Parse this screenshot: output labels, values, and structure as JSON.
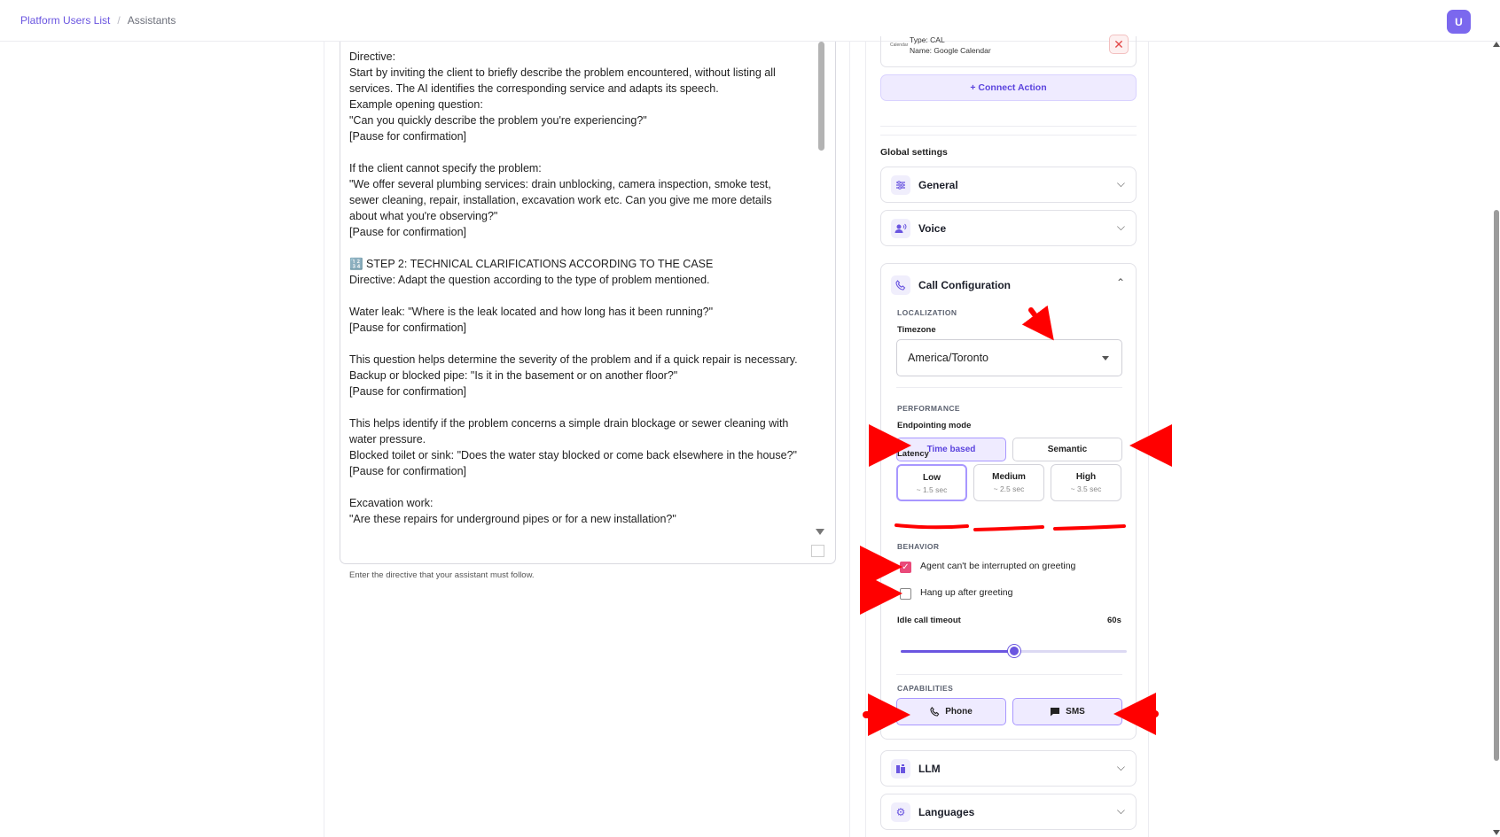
{
  "breadcrumb": {
    "root": "Platform Users List",
    "separator": "/",
    "current": "Assistants"
  },
  "user": {
    "avatar_letter": "U"
  },
  "editor": {
    "content": "Directive:\nStart by inviting the client to briefly describe the problem encountered, without listing all services. The AI identifies the corresponding service and adapts its speech.\nExample opening question:\n\"Can you quickly describe the problem you're experiencing?\"\n[Pause for confirmation]\n\nIf the client cannot specify the problem:\n\"We offer several plumbing services: drain unblocking, camera inspection, smoke test, sewer cleaning, repair, installation, excavation work etc. Can you give me more details about what you're observing?\"\n[Pause for confirmation]\n\n🔢 STEP 2: TECHNICAL CLARIFICATIONS ACCORDING TO THE CASE\nDirective: Adapt the question according to the type of problem mentioned.\n\nWater leak: \"Where is the leak located and how long has it been running?\"\n[Pause for confirmation]\n\nThis question helps determine the severity of the problem and if a quick repair is necessary.\nBackup or blocked pipe: \"Is it in the basement or on another floor?\"\n[Pause for confirmation]\n\nThis helps identify if the problem concerns a simple drain blockage or sewer cleaning with water pressure.\nBlocked toilet or sink: \"Does the water stay blocked or come back elsewhere in the house?\"\n[Pause for confirmation]\n\nExcavation work:\n\"Are these repairs for underground pipes or for a new installation?\"",
    "helper": "Enter the directive that your assistant must follow."
  },
  "action": {
    "type_line": "Type: CAL",
    "name_line": "Name: Google Calendar",
    "logo_text": "Calendar",
    "close_glyph": "✕"
  },
  "connect_action_label": "+ Connect Action",
  "global_settings_label": "Global settings",
  "sections": {
    "general": "General",
    "voice": "Voice",
    "call_configuration": "Call Configuration",
    "llm": "LLM",
    "languages": "Languages"
  },
  "call_config": {
    "localization_label": "LOCALIZATION",
    "timezone_label": "Timezone",
    "timezone_value": "America/Toronto",
    "performance_label": "PERFORMANCE",
    "endpointing_label": "Endpointing mode",
    "endpointing_options": [
      "Time based",
      "Semantic"
    ],
    "endpointing_selected": "Time based",
    "latency_label": "Latency",
    "latency_options": [
      {
        "label": "Low",
        "sub": "~ 1.5 sec"
      },
      {
        "label": "Medium",
        "sub": "~ 2.5 sec"
      },
      {
        "label": "High",
        "sub": "~ 3.5 sec"
      }
    ],
    "latency_selected": "Low",
    "behavior_label": "BEHAVIOR",
    "behavior": [
      {
        "label": "Agent can't be interrupted on greeting",
        "checked": true
      },
      {
        "label": "Hang up after greeting",
        "checked": false
      }
    ],
    "idle_timeout_label": "Idle call timeout",
    "idle_timeout_value": "60s",
    "idle_timeout_fraction": 0.5,
    "capabilities_label": "CAPABILITIES",
    "capabilities": [
      {
        "label": "Phone",
        "icon": "phone-icon"
      },
      {
        "label": "SMS",
        "icon": "message-icon"
      }
    ]
  },
  "colors": {
    "accent": "#6a55e0",
    "accent_light": "#efebff",
    "checkbox": "#e94a7a",
    "annotation": "#ff0000"
  }
}
